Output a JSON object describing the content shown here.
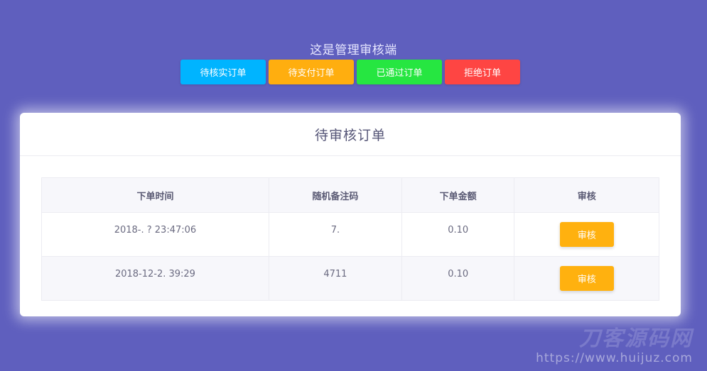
{
  "header": {
    "title": "这是管理审核端"
  },
  "nav": {
    "buttons": [
      {
        "label": "待核实订单",
        "color": "#00b4ff"
      },
      {
        "label": "待支付订单",
        "color": "#ffae0f"
      },
      {
        "label": "已通过订单",
        "color": "#26e641"
      },
      {
        "label": "拒绝订单",
        "color": "#fe4543"
      }
    ]
  },
  "card": {
    "title": "待审核订单"
  },
  "table": {
    "columns": [
      "下单时间",
      "随机备注码",
      "下单金额",
      "审核"
    ],
    "rows": [
      {
        "time": "2018-.    ? 23:47:06",
        "code": "7.",
        "amount": "0.10",
        "action": "审核"
      },
      {
        "time": "2018-12-2.     39:29",
        "code": "4711",
        "amount": "0.10",
        "action": "审核"
      }
    ]
  },
  "watermark": {
    "logo": "刀客源码网",
    "url": "https://www.huijuz.com"
  }
}
